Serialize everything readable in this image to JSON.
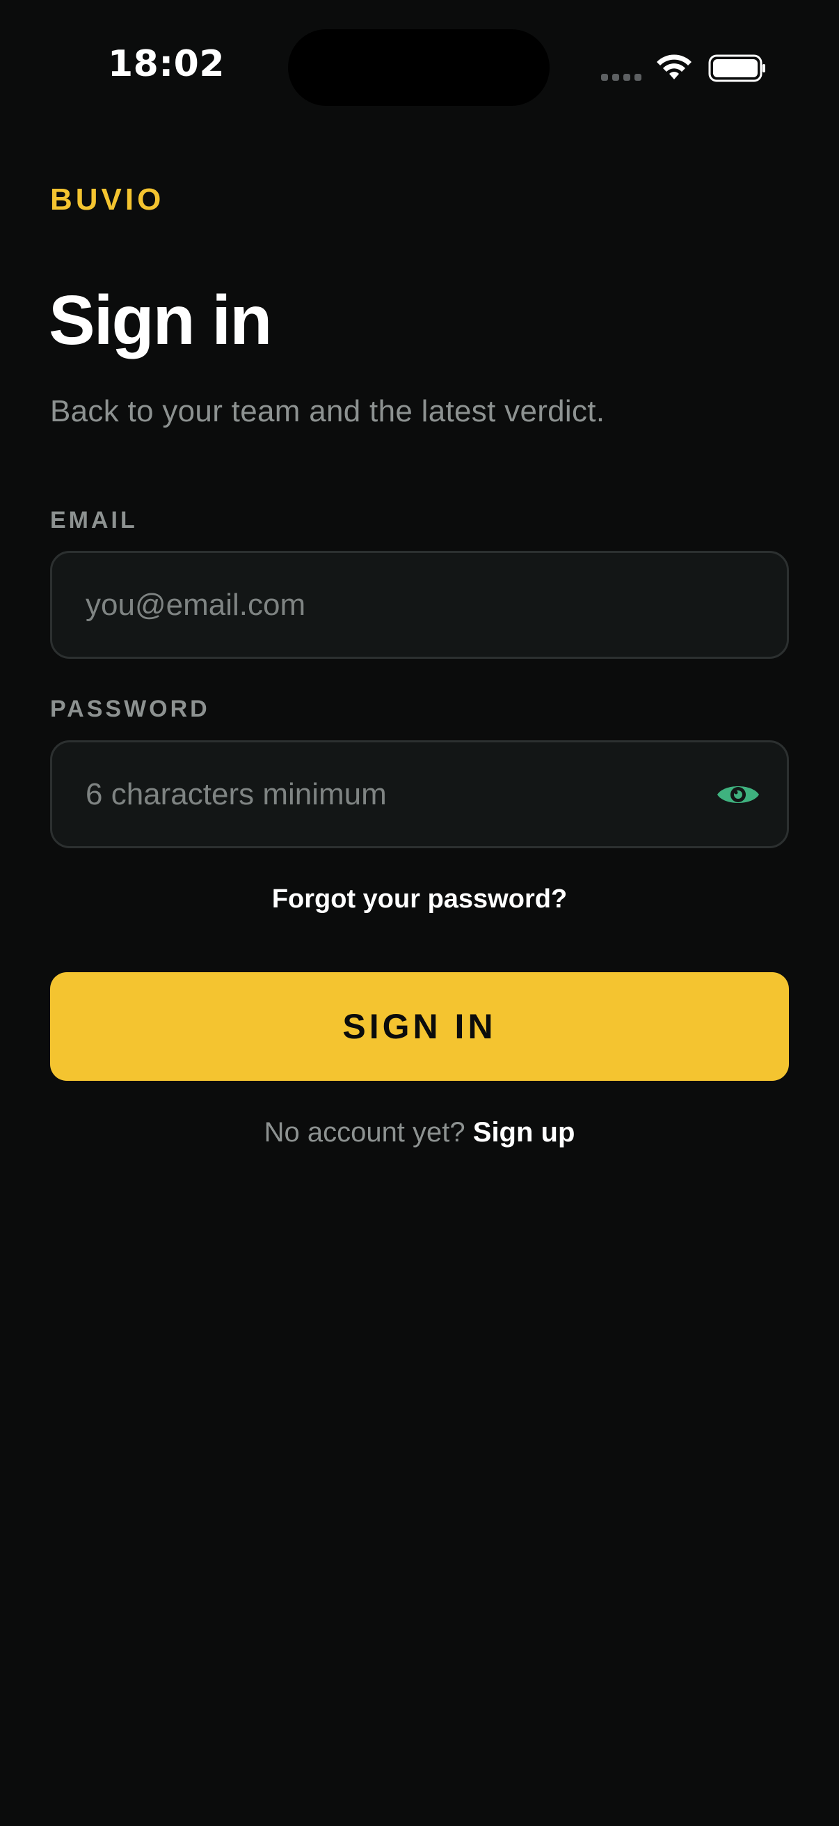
{
  "status_bar": {
    "time": "18:02"
  },
  "brand": {
    "name": "BUVIO",
    "color": "#f4c430"
  },
  "header": {
    "title": "Sign in",
    "subtitle": "Back to your team and the latest verdict."
  },
  "form": {
    "email": {
      "label": "EMAIL",
      "placeholder": "you@email.com",
      "value": ""
    },
    "password": {
      "label": "PASSWORD",
      "placeholder": "6 characters minimum",
      "value": "",
      "toggle_icon": "eye-icon",
      "toggle_color": "#3fb27f"
    },
    "forgot_link": "Forgot your password?",
    "submit_label": "SIGN IN"
  },
  "footer": {
    "prompt": "No account yet?",
    "signup_link": "Sign up"
  },
  "colors": {
    "background": "#0b0c0c",
    "accent": "#f4c430",
    "muted_text": "#8d9291"
  }
}
